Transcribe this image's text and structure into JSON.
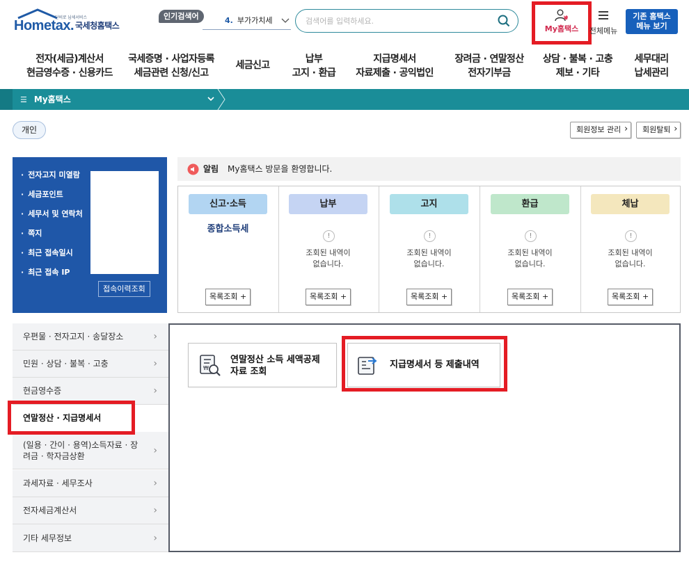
{
  "header": {
    "logo_word": "Hometax.",
    "logo_tiny": "단비로 납세서비스",
    "logo_org": "국세청홈택스",
    "popular_label": "인기검색어",
    "keyword_num": "4.",
    "keyword_text": "부가가치세",
    "search_placeholder": "검색어를 입력하세요.",
    "myhome_label": "My홈택스",
    "allmenu_label": "전체메뉴",
    "oldhome_line1": "기존 홈택스",
    "oldhome_line2": "메뉴 보기"
  },
  "gnb": [
    {
      "l1": "전자(세금)계산서",
      "l2": "현금영수증 · 신용카드"
    },
    {
      "l1": "국세증명 · 사업자등록",
      "l2": "세금관련 신청/신고"
    },
    {
      "l1": "세금신고",
      "l2": ""
    },
    {
      "l1": "납부",
      "l2": "고지 · 환급"
    },
    {
      "l1": "지급명세서",
      "l2": "자료제출 · 공익법인"
    },
    {
      "l1": "장려금 · 연말정산",
      "l2": "전자기부금"
    },
    {
      "l1": "상담 · 불복 · 고충",
      "l2": "제보 · 기타"
    },
    {
      "l1": "세무대리",
      "l2": "납세관리"
    }
  ],
  "locbar": {
    "label": "My홈택스"
  },
  "personal": {
    "pill": "개인",
    "member_manage": "회원정보 관리",
    "member_withdraw": "회원탈퇴"
  },
  "info": {
    "items": [
      "전자고지 미열람",
      "세금포인트",
      "세무서 및 연락처",
      "쪽지",
      "최근 접속일시",
      "최근 접속 IP"
    ],
    "history_btn": "접속이력조회"
  },
  "notice": {
    "tag": "알림",
    "message": "My홈택스 방문을 환영합니다."
  },
  "categories": [
    {
      "head": "신고·소득",
      "color": "#b2d5f2",
      "link": "종합소득세",
      "empty": "",
      "list": "목록조회 +"
    },
    {
      "head": "납부",
      "color": "#c5d4f3",
      "link": "",
      "empty": "조회된 내역이\n없습니다.",
      "list": "목록조회 +"
    },
    {
      "head": "고지",
      "color": "#aee0ea",
      "link": "",
      "empty": "조회된 내역이\n없습니다.",
      "list": "목록조회 +"
    },
    {
      "head": "환급",
      "color": "#bfe7cb",
      "link": "",
      "empty": "조회된 내역이\n없습니다.",
      "list": "목록조회 +"
    },
    {
      "head": "체납",
      "color": "#f4e7bd",
      "link": "",
      "empty": "조회된 내역이\n없습니다.",
      "list": "목록조회 +"
    }
  ],
  "left_menu": [
    {
      "label": "우편물 · 전자고지 · 송달장소",
      "active": false
    },
    {
      "label": "민원 · 상담 · 불복 · 고충",
      "active": false
    },
    {
      "label": "현금영수증",
      "active": false
    },
    {
      "label": "연말정산 · 지급명세서",
      "active": true
    },
    {
      "label": "(일용 · 간이 · 용역)소득자료 · 장려금 · 학자금상환",
      "active": false
    },
    {
      "label": "과세자료 · 세무조사",
      "active": false
    },
    {
      "label": "전자세금계산서",
      "active": false
    },
    {
      "label": "기타 세무정보",
      "active": false
    }
  ],
  "content_cards": [
    {
      "line1": "연말정산 소득 세액공제",
      "line2": "자료 조회",
      "icon": "document-search-icon"
    },
    {
      "line1": "지급명세서 등 제출내역",
      "line2": "",
      "icon": "document-send-icon"
    }
  ]
}
